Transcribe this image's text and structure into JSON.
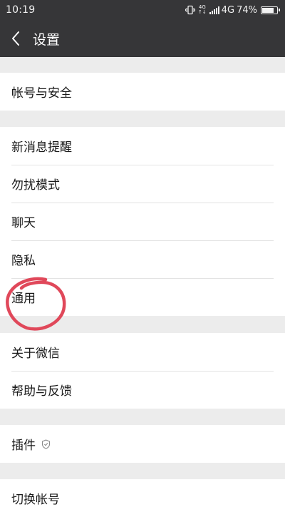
{
  "status_bar": {
    "time": "10:19",
    "net_top": "4G",
    "net_bottom": "↑↓",
    "network": "4G",
    "battery": "74%",
    "battery_level": 0.74
  },
  "nav": {
    "title": "设置"
  },
  "groups": [
    {
      "items": [
        "帐号与安全"
      ]
    },
    {
      "items": [
        "新消息提醒",
        "勿扰模式",
        "聊天",
        "隐私",
        "通用"
      ]
    },
    {
      "items": [
        "关于微信",
        "帮助与反馈"
      ]
    },
    {
      "items": [
        "插件"
      ]
    },
    {
      "items": [
        "切换帐号"
      ]
    }
  ],
  "colors": {
    "header_bg": "#363638",
    "page_bg": "#ececec",
    "annotation": "#e0485a"
  },
  "annotation": {
    "target": "通用",
    "shape": "hand-drawn circle"
  }
}
